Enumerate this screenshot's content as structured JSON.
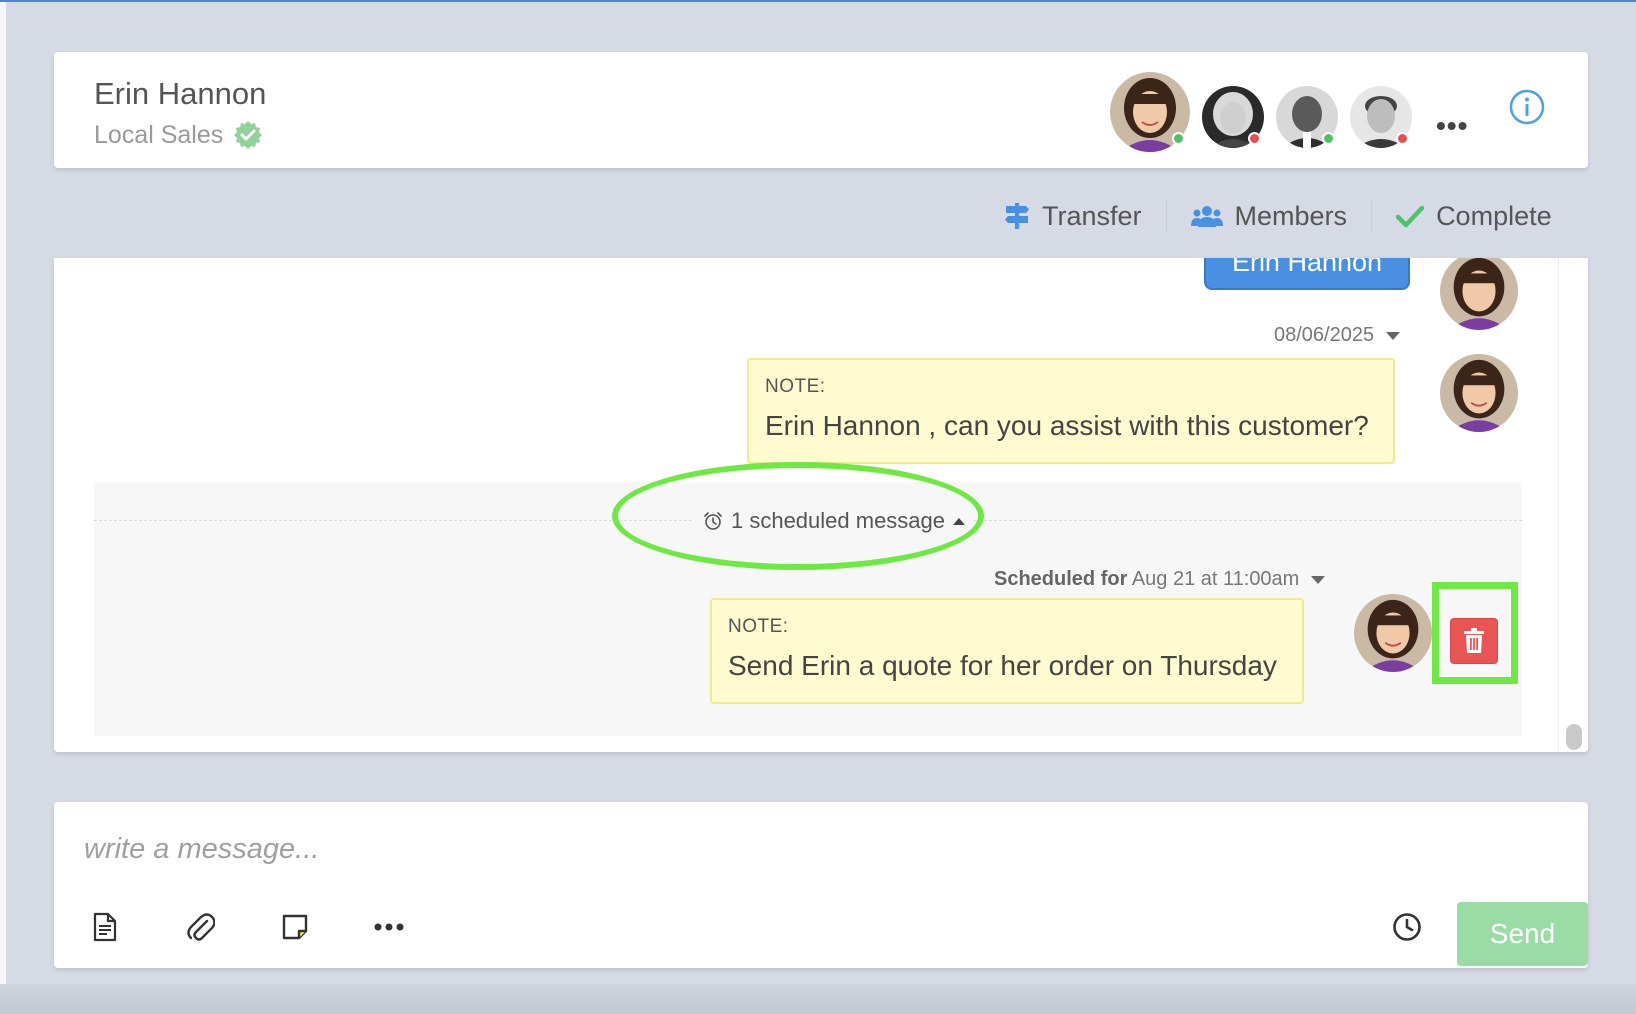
{
  "header": {
    "contact_name": "Erin Hannon",
    "contact_group": "Local Sales",
    "more_label": "•••"
  },
  "actions": {
    "transfer": "Transfer",
    "members": "Members",
    "complete": "Complete"
  },
  "chat": {
    "previous_bubble_text": "Erin Hannon",
    "message1": {
      "date": "08/06/2025",
      "label": "NOTE:",
      "text": "Erin Hannon , can you assist with this customer?"
    },
    "scheduled_toggle": "1 scheduled message",
    "scheduled": {
      "prefix": "Scheduled for",
      "time": "Aug 21 at 11:00am",
      "label": "NOTE:",
      "text": "Send Erin a quote for her order on Thursday"
    }
  },
  "composer": {
    "placeholder": "write a message...",
    "send_label": "Send"
  },
  "colors": {
    "accent_blue": "#4a90e2",
    "note_bg": "#fdfbcf",
    "delete_red": "#e95555",
    "send_green": "#9bdba6",
    "highlight_green": "#6ee843",
    "online": "#4cc26b",
    "offline": "#e85050"
  }
}
